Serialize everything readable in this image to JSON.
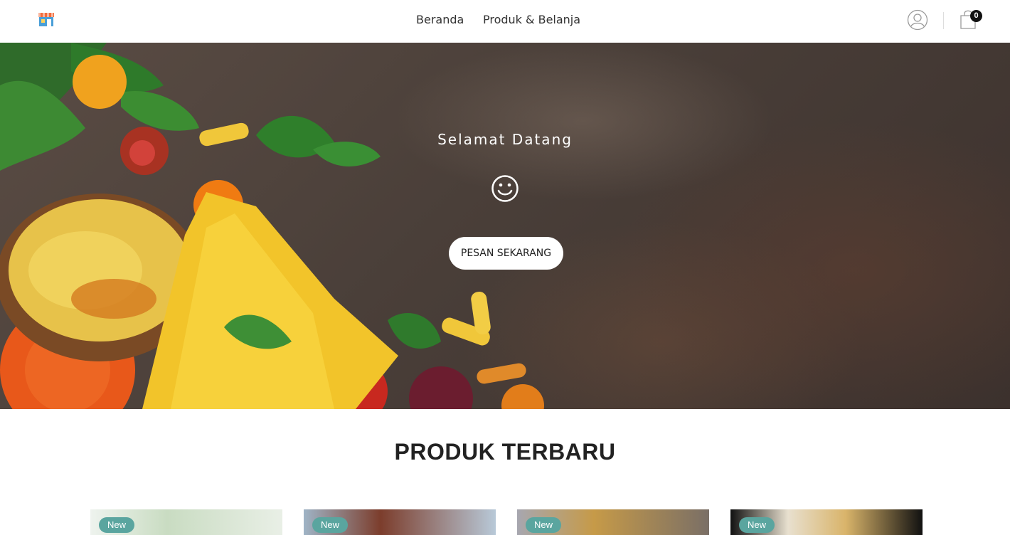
{
  "header": {
    "logo_icon": "shop-icon",
    "nav": [
      {
        "label": "Beranda"
      },
      {
        "label": "Produk & Belanja"
      }
    ],
    "user_icon": "user-icon",
    "cart_icon": "shopping-bag-icon",
    "cart_count": "0"
  },
  "hero": {
    "welcome": "Selamat Datang",
    "icon": "smiley-icon",
    "button_label": "PESAN SEKARANG"
  },
  "products": {
    "section_title": "PRODUK TERBARU",
    "cards": [
      {
        "badge": "New"
      },
      {
        "badge": "New"
      },
      {
        "badge": "New"
      },
      {
        "badge": "New"
      }
    ]
  },
  "colors": {
    "badge": "#5aa59f",
    "cart_badge": "#111111",
    "accent_text": "#222222"
  }
}
